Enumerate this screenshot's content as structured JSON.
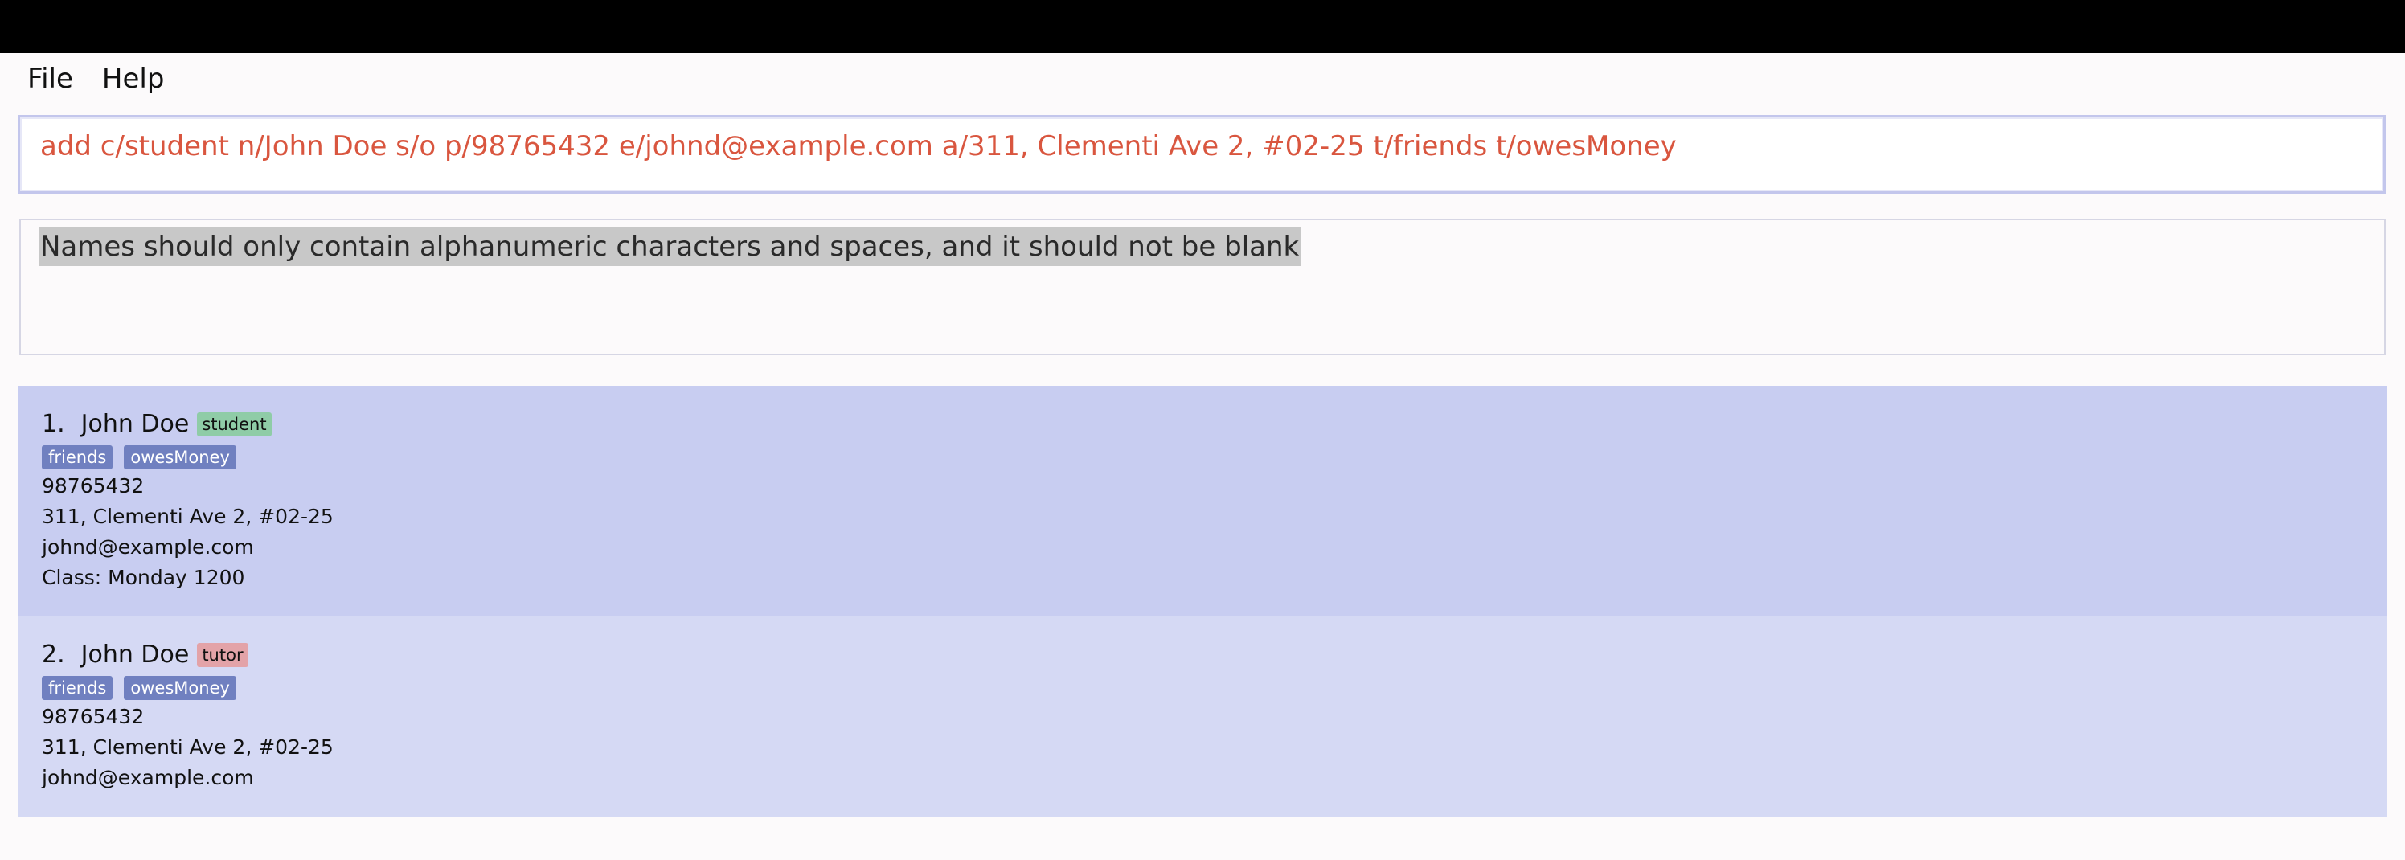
{
  "menu": {
    "file_label": "File",
    "help_label": "Help"
  },
  "command_box": {
    "value": "add c/student n/John Doe s/o p/98765432 e/johnd@example.com a/311, Clementi Ave 2, #02-25 t/friends t/owesMoney"
  },
  "result_display": {
    "message": "Names should only contain alphanumeric characters and spaces, and it should not be blank"
  },
  "persons": [
    {
      "index": "1.",
      "name": "John Doe",
      "role": "student",
      "tags": [
        "friends",
        "owesMoney"
      ],
      "phone": "98765432",
      "address": "311, Clementi Ave 2, #02-25",
      "email": "johnd@example.com",
      "class": "Class: Monday 1200"
    },
    {
      "index": "2.",
      "name": "John Doe",
      "role": "tutor",
      "tags": [
        "friends",
        "owesMoney"
      ],
      "phone": "98765432",
      "address": "311, Clementi Ave 2, #02-25",
      "email": "johnd@example.com"
    }
  ],
  "colors": {
    "command_error_text": "#d9563f",
    "selected_card": "#c8cdf1",
    "card": "#d5d9f4",
    "tag": "#7080c0",
    "student_badge": "#8fcca7",
    "tutor_badge": "#e3a3a8"
  }
}
